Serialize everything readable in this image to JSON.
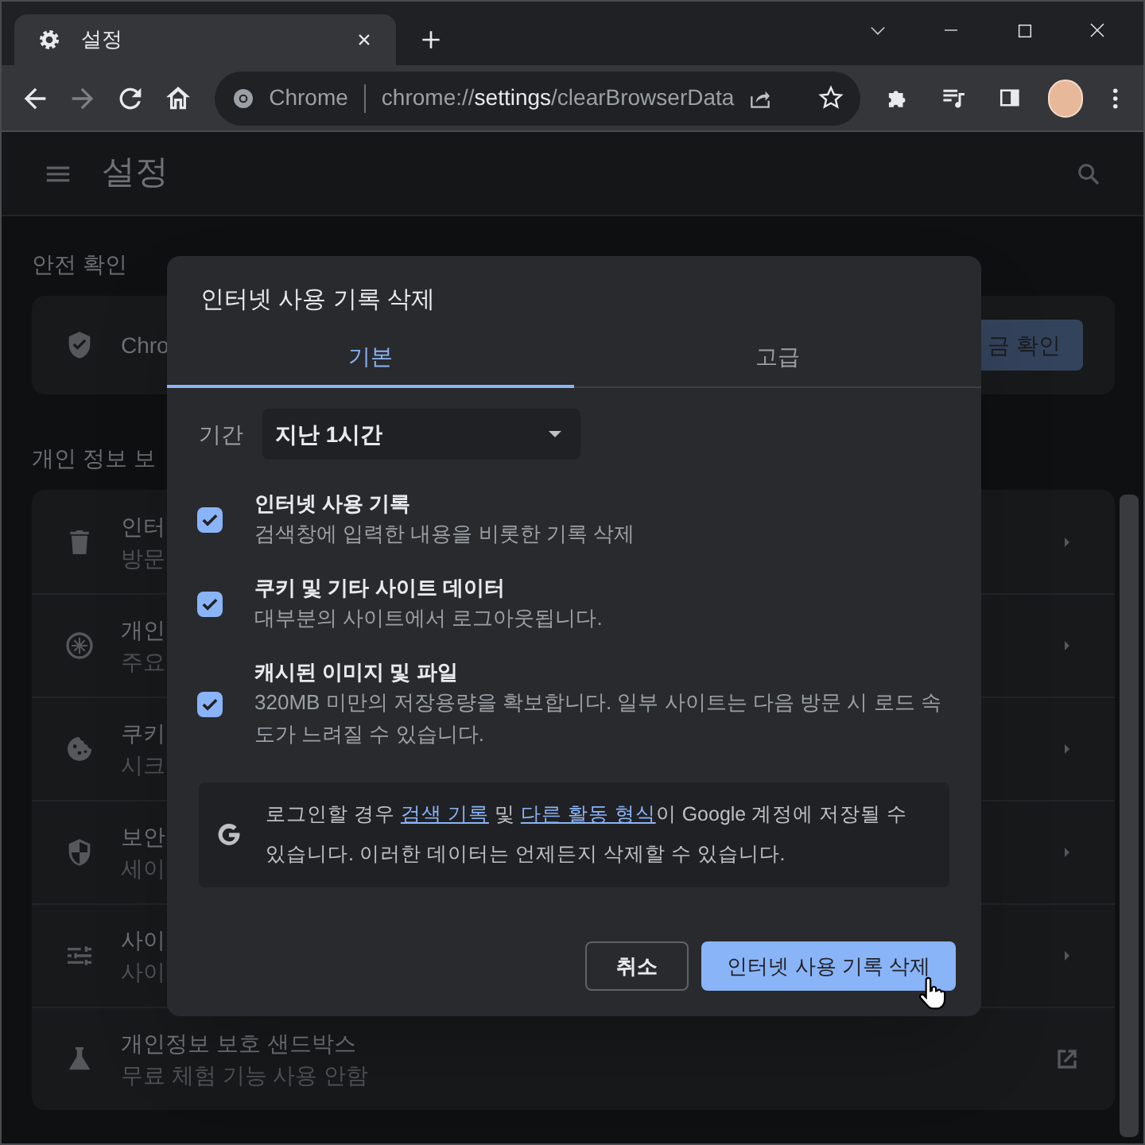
{
  "browser": {
    "tab": {
      "title": "설정",
      "selected": true
    },
    "nav_buttons": [
      {
        "kind": "back",
        "disabled": false
      },
      {
        "kind": "forward",
        "disabled": true
      },
      {
        "kind": "reload",
        "disabled": false
      },
      {
        "kind": "home",
        "disabled": false
      }
    ],
    "omnibox": {
      "chip": "Chrome",
      "url_parts": [
        {
          "text": "chrome://",
          "highlight": false
        },
        {
          "text": "settings",
          "highlight": true
        },
        {
          "text": "/clearBrowserData",
          "highlight": false
        }
      ]
    }
  },
  "settings": {
    "title": "설정",
    "sections": [
      {
        "heading": "안전 확인",
        "rows": [
          {
            "title": "Chro",
            "button": "금 확인"
          }
        ]
      },
      {
        "heading": "개인 정보 보",
        "rows": [
          {
            "title": "인터",
            "subtitle": "방문"
          },
          {
            "title": "개인",
            "subtitle": "주요"
          },
          {
            "title": "쿠키",
            "subtitle": "시크"
          },
          {
            "title": "보안",
            "subtitle": "세이"
          },
          {
            "title": "사이",
            "subtitle": "사이"
          },
          {
            "title": "개인정보 보호 샌드박스",
            "subtitle": "무료 체험 기능 사용 안함"
          }
        ]
      }
    ]
  },
  "dialog": {
    "title": "인터넷 사용 기록 삭제",
    "tabs": [
      {
        "label": "기본",
        "selected": true
      },
      {
        "label": "고급",
        "selected": false
      }
    ],
    "period": {
      "label": "기간",
      "value": "지난 1시간"
    },
    "options": [
      {
        "title": "인터넷 사용 기록",
        "description": "검색창에 입력한 내용을 비롯한 기록 삭제",
        "checked": true
      },
      {
        "title": "쿠키 및 기타 사이트 데이터",
        "description": "대부분의 사이트에서 로그아웃됩니다.",
        "checked": true
      },
      {
        "title": "캐시된 이미지 및 파일",
        "description": "320MB 미만의 저장용량을 확보합니다. 일부 사이트는 다음 방문 시 로드 속도가 느려질 수 있습니다.",
        "checked": true
      }
    ],
    "notice": [
      {
        "kind": "text",
        "text": "로그인할 경우 "
      },
      {
        "kind": "link",
        "text": "검색 기록"
      },
      {
        "kind": "text",
        "text": " 및 "
      },
      {
        "kind": "link",
        "text": "다른 활동 형식"
      },
      {
        "kind": "text",
        "text": "이 Google 계정에 저장될 수 있습니다. 이러한 데이터는 언제든지 삭제할 수 있습니다."
      }
    ],
    "buttons": [
      {
        "label": "취소",
        "kind": "secondary"
      },
      {
        "label": "인터넷 사용 기록 삭제",
        "kind": "primary"
      }
    ]
  }
}
